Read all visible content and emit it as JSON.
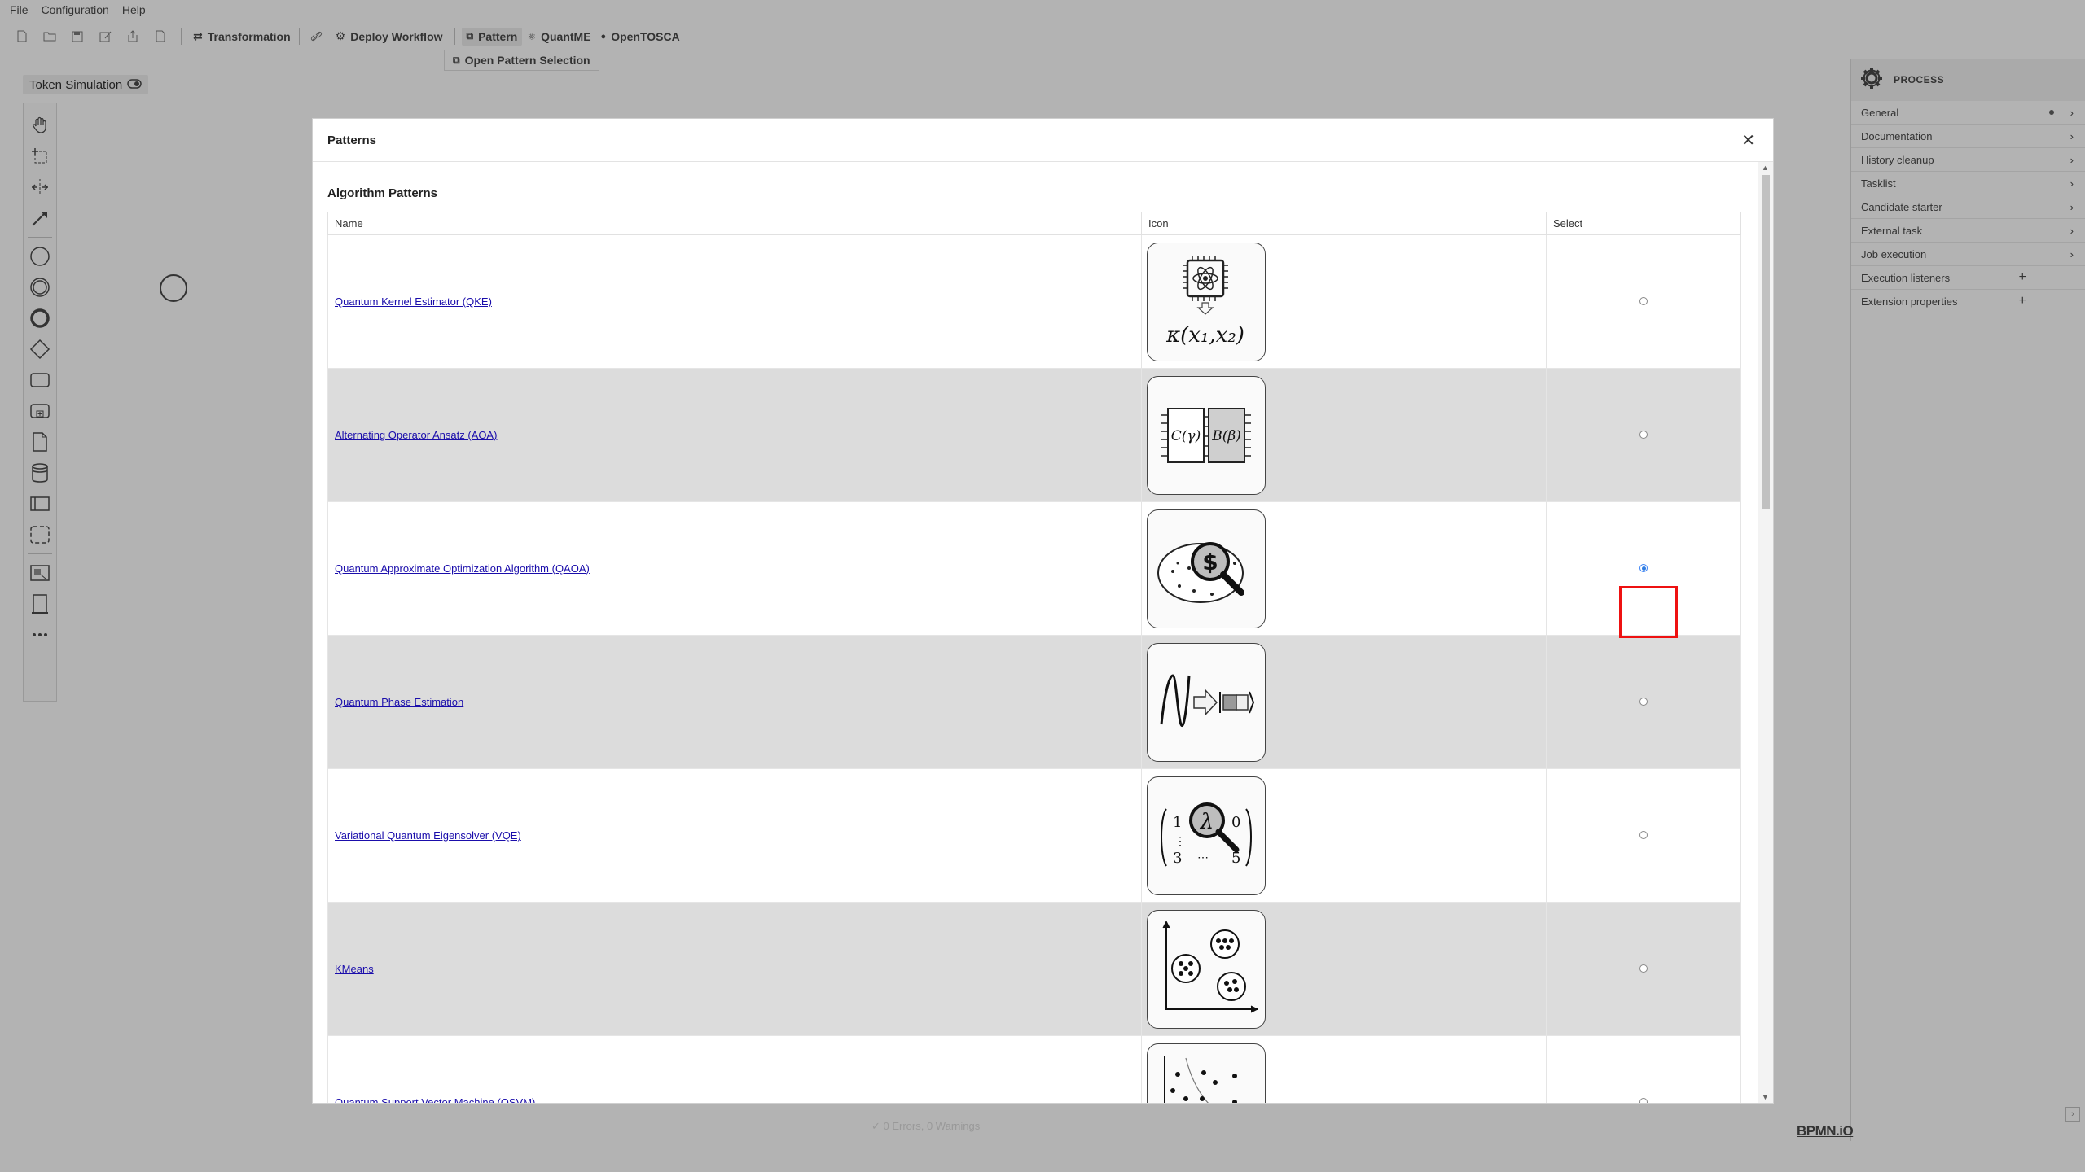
{
  "menu": [
    "File",
    "Configuration",
    "Help"
  ],
  "toolbar": {
    "transformation": "Transformation",
    "deploy_workflow": "Deploy Workflow",
    "pattern": "Pattern",
    "quantme": "QuantME",
    "opentosca": "OpenTOSCA"
  },
  "pattern_submenu": "Open Pattern Selection",
  "token_simulation": "Token Simulation",
  "properties": {
    "title": "PROCESS",
    "rows": [
      {
        "label": "General"
      },
      {
        "label": "Documentation"
      },
      {
        "label": "History cleanup"
      },
      {
        "label": "Tasklist"
      },
      {
        "label": "Candidate starter"
      },
      {
        "label": "External task"
      },
      {
        "label": "Job execution"
      },
      {
        "label": "Execution listeners"
      },
      {
        "label": "Extension properties"
      }
    ]
  },
  "status": "0 Errors, 0 Warnings",
  "logo": "BPMN.iO",
  "modal": {
    "title": "Patterns",
    "section": "Algorithm Patterns",
    "columns": [
      "Name",
      "Icon",
      "Select"
    ],
    "rows": [
      {
        "name": "Quantum Kernel Estimator (QKE)",
        "icon": "qke-icon",
        "selected": false
      },
      {
        "name": "Alternating Operator Ansatz (AOA)",
        "icon": "aoa-icon",
        "selected": false
      },
      {
        "name": "Quantum Approximate Optimization Algorithm (QAOA)",
        "icon": "qaoa-icon",
        "selected": true
      },
      {
        "name": "Quantum Phase Estimation",
        "icon": "qpe-icon",
        "selected": false
      },
      {
        "name": "Variational Quantum Eigensolver (VQE)",
        "icon": "vqe-icon",
        "selected": false
      },
      {
        "name": "KMeans",
        "icon": "kmeans-icon",
        "selected": false
      },
      {
        "name": "Quantum Support Vector Machine (QSVM)",
        "icon": "qsvm-icon",
        "selected": false
      }
    ]
  }
}
